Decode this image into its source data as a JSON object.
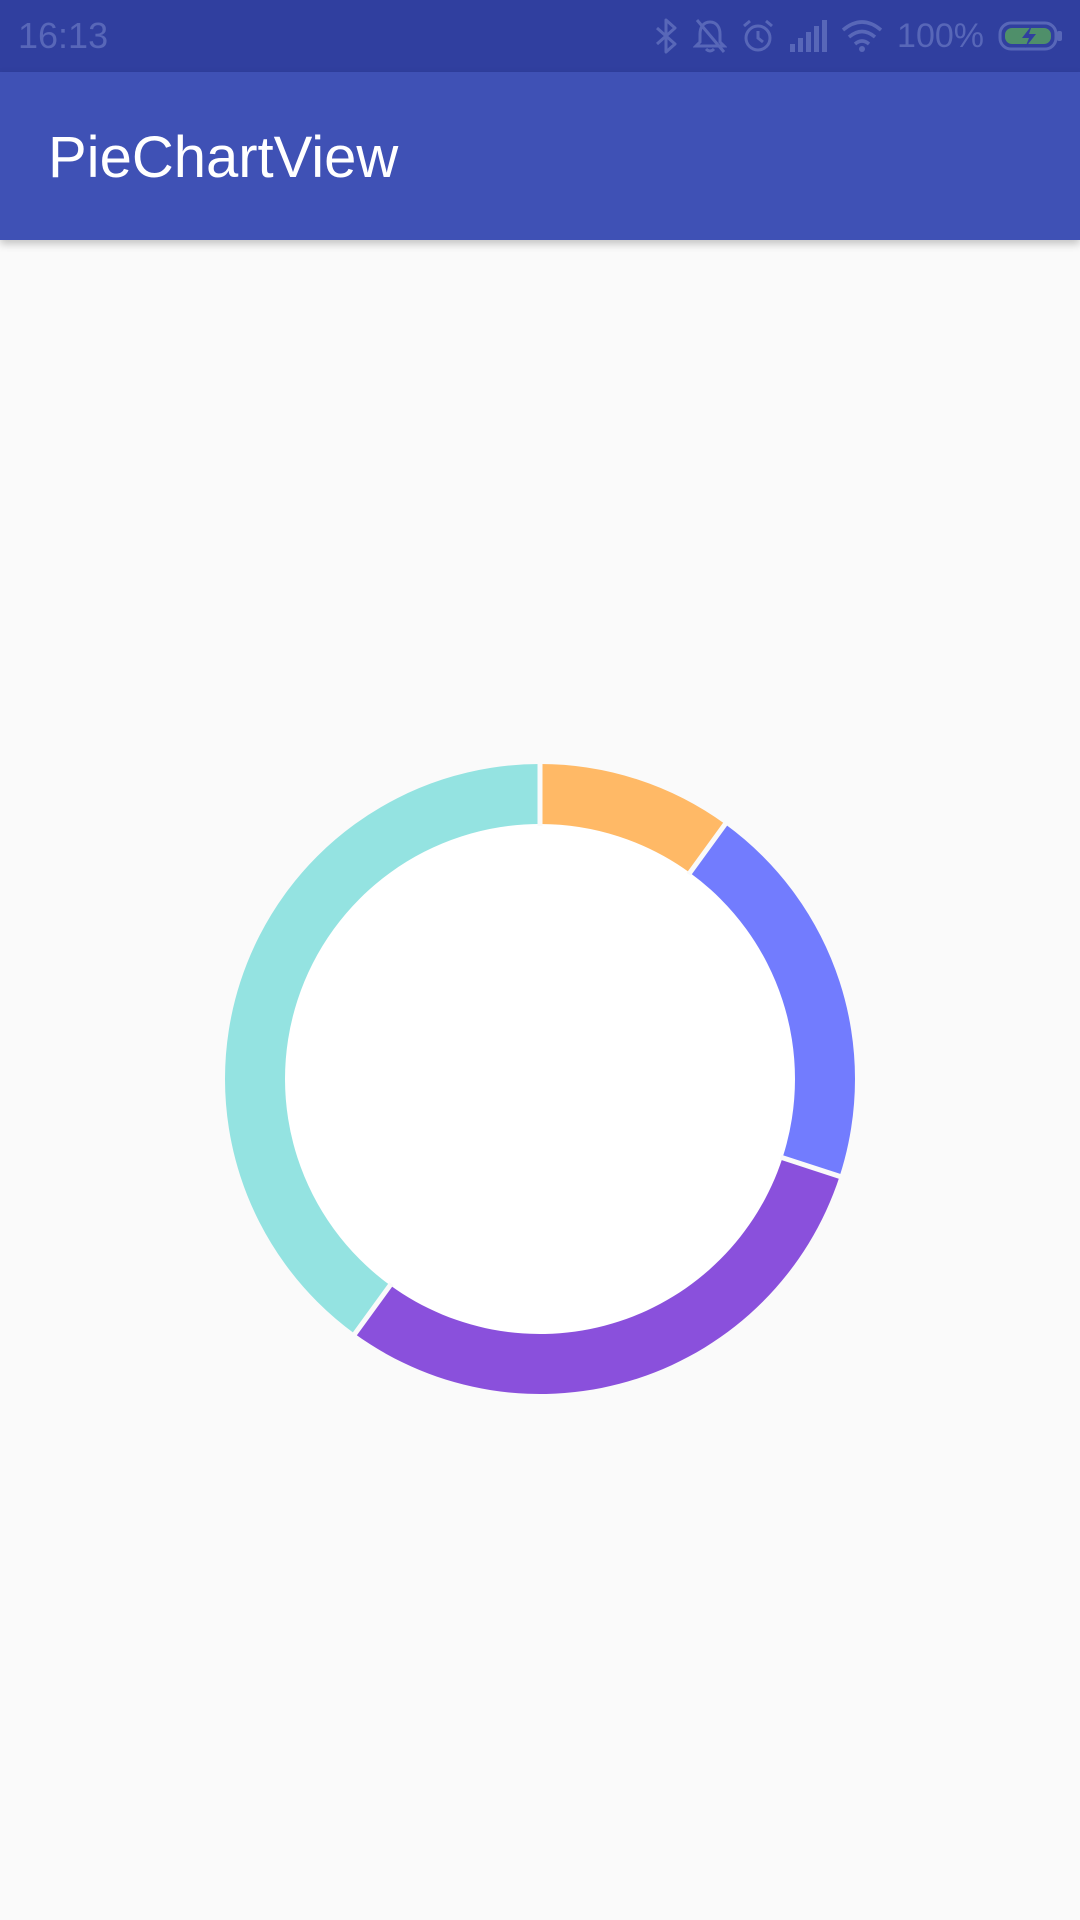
{
  "status_bar": {
    "time": "16:13",
    "battery_percent": "100%",
    "icons": [
      "bluetooth-icon",
      "notifications-off-icon",
      "alarm-icon",
      "signal-icon",
      "wifi-icon",
      "battery-charging-icon"
    ]
  },
  "app_bar": {
    "title": "PieChartView"
  },
  "chart_data": {
    "type": "pie",
    "variant": "donut",
    "start_angle_deg": -90,
    "direction": "clockwise",
    "slices": [
      {
        "value": 10,
        "color": "#ffb966"
      },
      {
        "value": 20,
        "color": "#727cfe"
      },
      {
        "value": 30,
        "color": "#8a50dc"
      },
      {
        "value": 40,
        "color": "#94e3e1"
      }
    ],
    "center_color": "#ffffff",
    "separator_color": "#fafafa",
    "title": "",
    "legend": "none"
  }
}
